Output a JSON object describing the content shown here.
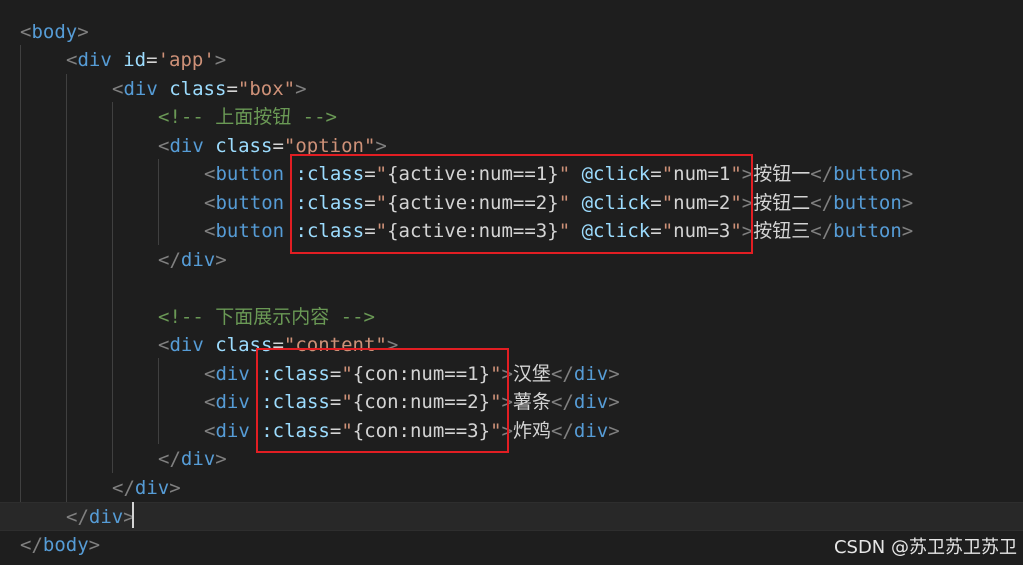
{
  "lines": [
    {
      "id": "l1",
      "tokens": [
        [
          "t",
          "<"
        ],
        [
          "tn",
          "body"
        ],
        [
          "t",
          ">"
        ]
      ]
    },
    {
      "id": "l2",
      "tokens": [
        [
          "t",
          "<"
        ],
        [
          "tn",
          "div"
        ],
        [
          "op",
          " "
        ],
        [
          "at",
          "id"
        ],
        [
          "op",
          "="
        ],
        [
          "st",
          "'app'"
        ],
        [
          "t",
          ">"
        ]
      ]
    },
    {
      "id": "l3",
      "tokens": [
        [
          "t",
          "<"
        ],
        [
          "tn",
          "div"
        ],
        [
          "op",
          " "
        ],
        [
          "at",
          "class"
        ],
        [
          "op",
          "="
        ],
        [
          "st",
          "\"box\""
        ],
        [
          "t",
          ">"
        ]
      ]
    },
    {
      "id": "l4",
      "tokens": [
        [
          "cm",
          "<!-- 上面按钮 -->"
        ]
      ]
    },
    {
      "id": "l5",
      "tokens": [
        [
          "t",
          "<"
        ],
        [
          "tn",
          "div"
        ],
        [
          "op",
          " "
        ],
        [
          "at",
          "class"
        ],
        [
          "op",
          "="
        ],
        [
          "st",
          "\"option\""
        ],
        [
          "t",
          ">"
        ]
      ]
    },
    {
      "id": "l6",
      "tokens": [
        [
          "t",
          "<"
        ],
        [
          "tn",
          "button"
        ],
        [
          "op",
          " "
        ],
        [
          "at",
          ":class"
        ],
        [
          "op",
          "="
        ],
        [
          "st",
          "\""
        ],
        [
          "op",
          "{active:num==1}"
        ],
        [
          "st",
          "\""
        ],
        [
          "op",
          " "
        ],
        [
          "at",
          "@click"
        ],
        [
          "op",
          "="
        ],
        [
          "st",
          "\""
        ],
        [
          "op",
          "num=1"
        ],
        [
          "st",
          "\""
        ],
        [
          "t",
          ">"
        ],
        [
          "tx",
          "按钮一"
        ],
        [
          "t",
          "</"
        ],
        [
          "tn",
          "button"
        ],
        [
          "t",
          ">"
        ]
      ]
    },
    {
      "id": "l7",
      "tokens": [
        [
          "t",
          "<"
        ],
        [
          "tn",
          "button"
        ],
        [
          "op",
          " "
        ],
        [
          "at",
          ":class"
        ],
        [
          "op",
          "="
        ],
        [
          "st",
          "\""
        ],
        [
          "op",
          "{active:num==2}"
        ],
        [
          "st",
          "\""
        ],
        [
          "op",
          " "
        ],
        [
          "at",
          "@click"
        ],
        [
          "op",
          "="
        ],
        [
          "st",
          "\""
        ],
        [
          "op",
          "num=2"
        ],
        [
          "st",
          "\""
        ],
        [
          "t",
          ">"
        ],
        [
          "tx",
          "按钮二"
        ],
        [
          "t",
          "</"
        ],
        [
          "tn",
          "button"
        ],
        [
          "t",
          ">"
        ]
      ]
    },
    {
      "id": "l8",
      "tokens": [
        [
          "t",
          "<"
        ],
        [
          "tn",
          "button"
        ],
        [
          "op",
          " "
        ],
        [
          "at",
          ":class"
        ],
        [
          "op",
          "="
        ],
        [
          "st",
          "\""
        ],
        [
          "op",
          "{active:num==3}"
        ],
        [
          "st",
          "\""
        ],
        [
          "op",
          " "
        ],
        [
          "at",
          "@click"
        ],
        [
          "op",
          "="
        ],
        [
          "st",
          "\""
        ],
        [
          "op",
          "num=3"
        ],
        [
          "st",
          "\""
        ],
        [
          "t",
          ">"
        ],
        [
          "tx",
          "按钮三"
        ],
        [
          "t",
          "</"
        ],
        [
          "tn",
          "button"
        ],
        [
          "t",
          ">"
        ]
      ]
    },
    {
      "id": "l9",
      "tokens": [
        [
          "t",
          "</"
        ],
        [
          "tn",
          "div"
        ],
        [
          "t",
          ">"
        ]
      ]
    },
    {
      "id": "l10",
      "tokens": []
    },
    {
      "id": "l11",
      "tokens": [
        [
          "cm",
          "<!-- 下面展示内容 -->"
        ]
      ]
    },
    {
      "id": "l12",
      "tokens": [
        [
          "t",
          "<"
        ],
        [
          "tn",
          "div"
        ],
        [
          "op",
          " "
        ],
        [
          "at",
          "class"
        ],
        [
          "op",
          "="
        ],
        [
          "st",
          "\"content\""
        ],
        [
          "t",
          ">"
        ]
      ]
    },
    {
      "id": "l13",
      "tokens": [
        [
          "t",
          "<"
        ],
        [
          "tn",
          "div"
        ],
        [
          "op",
          " "
        ],
        [
          "at",
          ":class"
        ],
        [
          "op",
          "="
        ],
        [
          "st",
          "\""
        ],
        [
          "op",
          "{con:num==1}"
        ],
        [
          "st",
          "\""
        ],
        [
          "t",
          ">"
        ],
        [
          "tx",
          "汉堡"
        ],
        [
          "t",
          "</"
        ],
        [
          "tn",
          "div"
        ],
        [
          "t",
          ">"
        ]
      ]
    },
    {
      "id": "l14",
      "tokens": [
        [
          "t",
          "<"
        ],
        [
          "tn",
          "div"
        ],
        [
          "op",
          " "
        ],
        [
          "at",
          ":class"
        ],
        [
          "op",
          "="
        ],
        [
          "st",
          "\""
        ],
        [
          "op",
          "{con:num==2}"
        ],
        [
          "st",
          "\""
        ],
        [
          "t",
          ">"
        ],
        [
          "tx",
          "薯条"
        ],
        [
          "t",
          "</"
        ],
        [
          "tn",
          "div"
        ],
        [
          "t",
          ">"
        ]
      ]
    },
    {
      "id": "l15",
      "tokens": [
        [
          "t",
          "<"
        ],
        [
          "tn",
          "div"
        ],
        [
          "op",
          " "
        ],
        [
          "at",
          ":class"
        ],
        [
          "op",
          "="
        ],
        [
          "st",
          "\""
        ],
        [
          "op",
          "{con:num==3}"
        ],
        [
          "st",
          "\""
        ],
        [
          "t",
          ">"
        ],
        [
          "tx",
          "炸鸡"
        ],
        [
          "t",
          "</"
        ],
        [
          "tn",
          "div"
        ],
        [
          "t",
          ">"
        ]
      ]
    },
    {
      "id": "l16",
      "tokens": [
        [
          "t",
          "</"
        ],
        [
          "tn",
          "div"
        ],
        [
          "t",
          ">"
        ]
      ]
    },
    {
      "id": "l17",
      "tokens": [
        [
          "t",
          "</"
        ],
        [
          "tn",
          "div"
        ],
        [
          "t",
          ">"
        ]
      ]
    },
    {
      "id": "l18",
      "tokens": [
        [
          "t",
          "</"
        ],
        [
          "tn",
          "div"
        ],
        [
          "t",
          ">"
        ]
      ]
    },
    {
      "id": "l19",
      "tokens": [
        [
          "t",
          "</"
        ],
        [
          "tn",
          "body"
        ],
        [
          "t",
          ">"
        ]
      ]
    }
  ],
  "watermark": "CSDN @苏卫苏卫苏卫",
  "colors": {
    "background": "#1e1e1e",
    "tag": "#569cd6",
    "attribute": "#9cdcfe",
    "string": "#ce9178",
    "comment": "#6a9955",
    "punctuation": "#808080",
    "highlight_box": "#e21e23"
  }
}
